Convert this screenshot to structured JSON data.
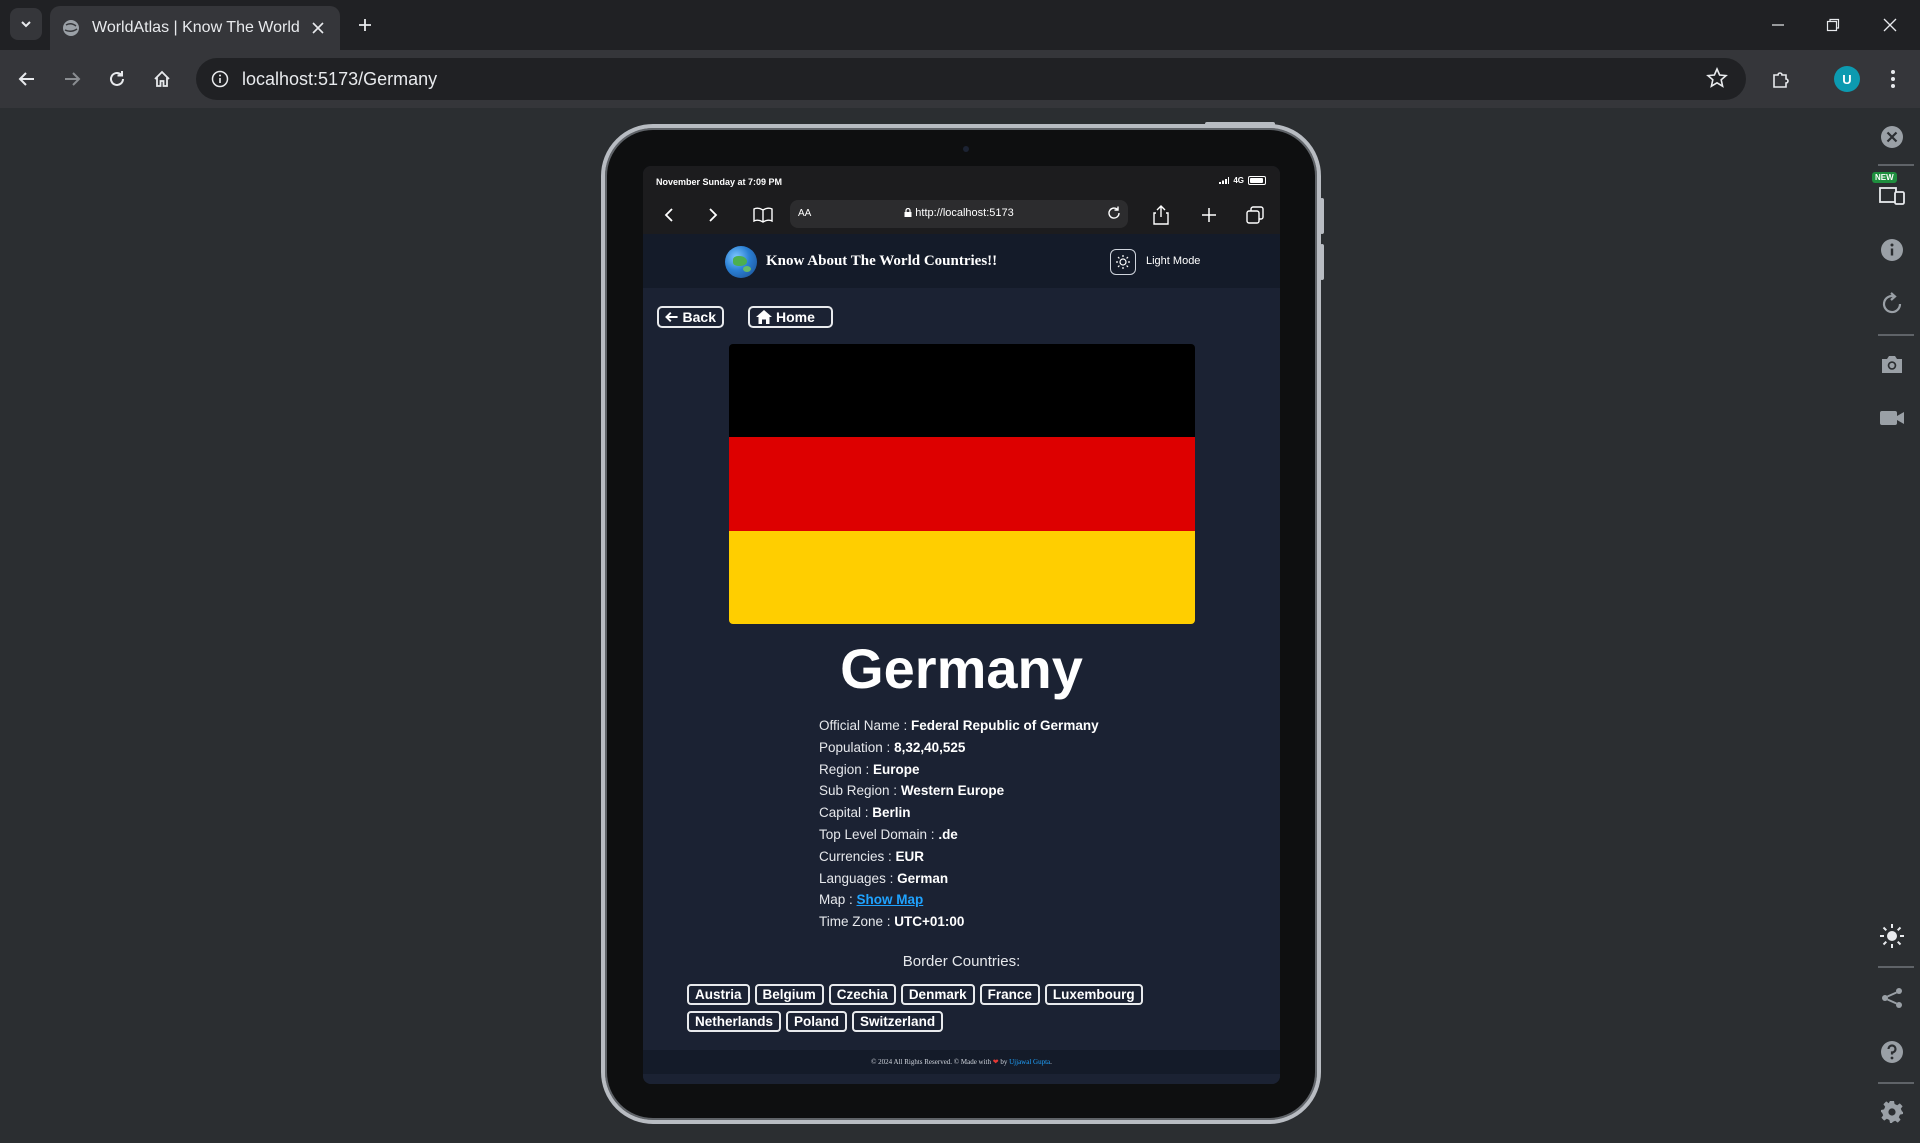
{
  "browser": {
    "tab_title": "WorldAtlas | Know The World | I",
    "address": "localhost:5173/Germany",
    "profile_initial": "U"
  },
  "device": {
    "status_time": "November Sunday at 7:09 PM",
    "network": "4G",
    "safari_aa": "AA",
    "safari_url": "http://localhost:5173"
  },
  "app": {
    "title": "Know About The World Countries!!",
    "mode_label": "Light Mode",
    "back_label": "Back",
    "home_label": "Home"
  },
  "country": {
    "name": "Germany",
    "flag_colors": [
      "#000000",
      "#DD0000",
      "#FFCE00"
    ],
    "facts": [
      {
        "label": "Official Name : ",
        "value": "Federal Republic of Germany"
      },
      {
        "label": "Population : ",
        "value": "8,32,40,525"
      },
      {
        "label": "Region : ",
        "value": "Europe"
      },
      {
        "label": "Sub Region : ",
        "value": "Western Europe"
      },
      {
        "label": "Capital : ",
        "value": "Berlin"
      },
      {
        "label": "Top Level Domain : ",
        "value": ".de"
      },
      {
        "label": "Currencies : ",
        "value": "EUR"
      },
      {
        "label": "Languages : ",
        "value": "German"
      },
      {
        "label": "Map : ",
        "value": "Show Map"
      },
      {
        "label": "Time Zone : ",
        "value": "UTC+01:00"
      }
    ],
    "border_title": "Border Countries:",
    "borders": [
      "Austria",
      "Belgium",
      "Czechia",
      "Denmark",
      "France",
      "Luxembourg",
      "Netherlands",
      "Poland",
      "Switzerland"
    ]
  },
  "footer": {
    "text": "© 2024 All Rights Reserved. © Made with",
    "by": " by ",
    "author": "Ujjawal Gupta",
    "end": "."
  }
}
